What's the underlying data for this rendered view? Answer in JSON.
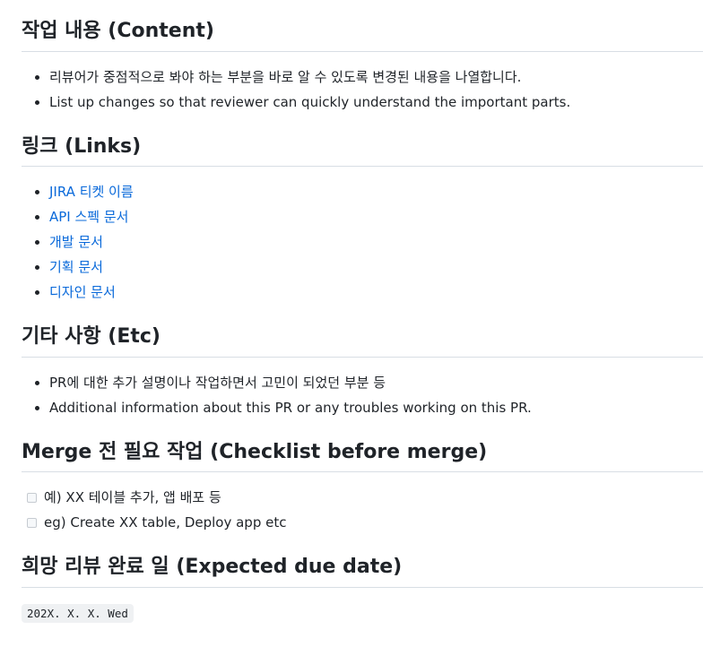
{
  "sections": {
    "content": {
      "heading": "작업 내용 (Content)",
      "items": [
        "리뷰어가 중점적으로 봐야 하는 부분을 바로 알 수 있도록 변경된 내용을 나열합니다.",
        "List up changes so that reviewer can quickly understand the important parts."
      ]
    },
    "links": {
      "heading": "링크 (Links)",
      "items": [
        "JIRA 티켓 이름",
        "API 스펙 문서",
        "개발 문서",
        "기획 문서",
        "디자인 문서"
      ]
    },
    "etc": {
      "heading": "기타 사항 (Etc)",
      "items": [
        "PR에 대한 추가 설명이나 작업하면서 고민이 되었던 부분 등",
        "Additional information about this PR or any troubles working on this PR."
      ]
    },
    "checklist": {
      "heading": "Merge 전 필요 작업 (Checklist before merge)",
      "items": [
        "예) XX 테이블 추가, 앱 배포 등",
        "eg) Create XX table, Deploy app etc"
      ]
    },
    "due": {
      "heading": "희망 리뷰 완료 일 (Expected due date)",
      "code": "202X. X. X. Wed"
    }
  },
  "colors": {
    "link": "#0969da",
    "text": "#1f2328",
    "border": "#d8dee4"
  }
}
